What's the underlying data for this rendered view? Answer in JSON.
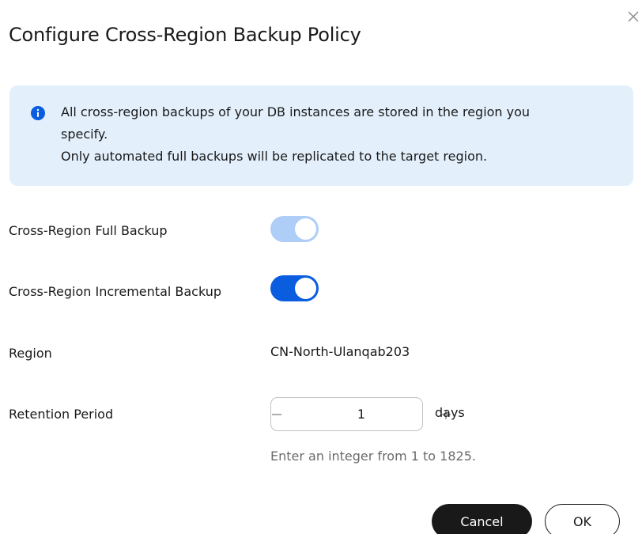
{
  "dialog": {
    "title": "Configure Cross-Region Backup Policy",
    "close_icon": "close-icon"
  },
  "notice": {
    "icon": "info-icon",
    "line1": "All cross-region backups of your DB instances are stored in the region you",
    "line2": "specify.",
    "line3": "Only automated full backups will be replicated to the target region."
  },
  "form": {
    "full_backup": {
      "label": "Cross-Region Full Backup",
      "enabled": true,
      "disabled": true
    },
    "incremental_backup": {
      "label": "Cross-Region Incremental Backup",
      "enabled": true
    },
    "region": {
      "label": "Region",
      "value": "CN-North-Ulanqab203"
    },
    "retention": {
      "label": "Retention Period",
      "value": "1",
      "decrement_symbol": "−",
      "increment_symbol": "+",
      "unit": "days",
      "hint": "Enter an integer from 1 to 1825."
    }
  },
  "footer": {
    "cancel_label": "Cancel",
    "ok_label": "OK"
  },
  "colors": {
    "primary": "#0a5ddf",
    "primary_disabled": "#aecdf7",
    "notice_bg": "#e3f0fc",
    "text": "#191919",
    "hint": "#6b6b6b"
  }
}
